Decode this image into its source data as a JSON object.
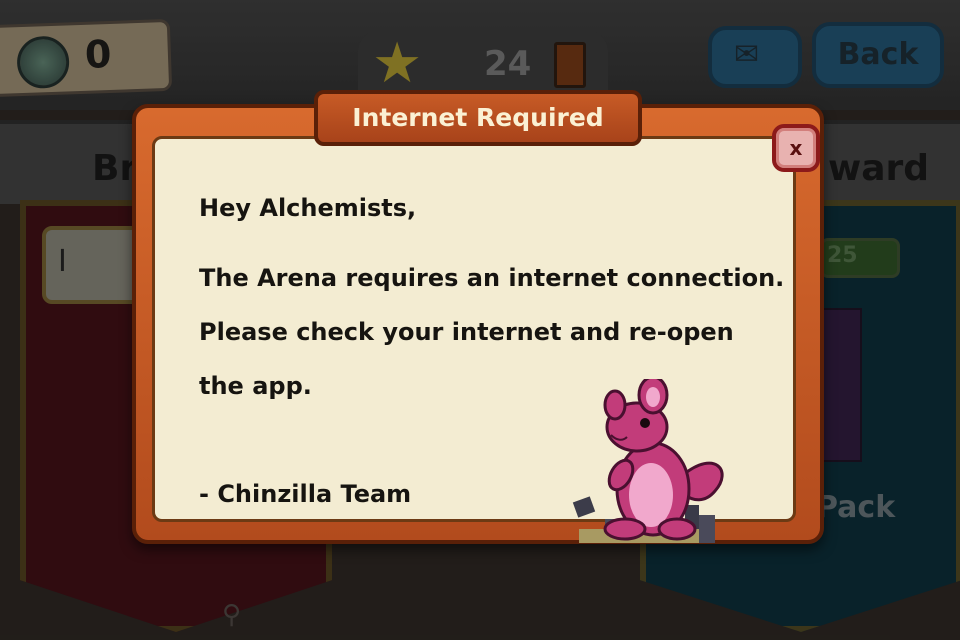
{
  "topbar": {
    "gems": "0",
    "stars": "24",
    "back_label": "Back"
  },
  "background": {
    "left_header": "Br",
    "right_header": "ward",
    "left_field_value": "I",
    "right_progress_value": "25",
    "pack_label": "Pack"
  },
  "dialog": {
    "title": "Internet Required",
    "close_label": "x",
    "greeting": "Hey Alchemists,",
    "lines": [
      "The Arena requires an internet connection.",
      "Please check your internet and re-open",
      "the app."
    ],
    "signature": "- Chinzilla Team"
  },
  "colors": {
    "dialog_frame": "#c8592a",
    "paper": "#f3ecd2",
    "title_text": "#fbf1d4",
    "close_button": "#e8b2b0",
    "mascot": "#c23c7a"
  },
  "icons": [
    "gem-icon",
    "star-icon",
    "card-icon",
    "mail-icon",
    "close-icon",
    "bone-icon"
  ]
}
